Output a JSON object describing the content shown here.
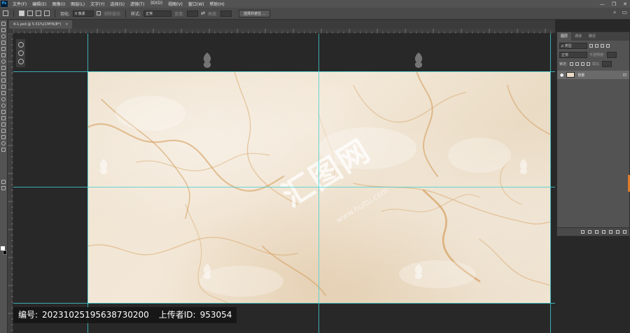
{
  "app": {
    "logo_text": "Ps"
  },
  "menu": [
    "文件(F)",
    "编辑(E)",
    "图像(I)",
    "图层(L)",
    "文字(Y)",
    "选择(S)",
    "滤镜(T)",
    "3D(D)",
    "视图(V)",
    "窗口(W)",
    "帮助(H)"
  ],
  "window_controls": {
    "minimize": "—",
    "restore": "❐",
    "close": "✕"
  },
  "options": {
    "feather_label": "羽化:",
    "feather_value": "0 像素",
    "antialias_label": "消除锯齿",
    "style_label": "样式:",
    "style_value": "正常",
    "width_label": "宽度:",
    "height_label": "高度:",
    "select_mask_button": "选择并遮住 ...",
    "search_icon": "⌕",
    "workspace_icon": "▭"
  },
  "document": {
    "tab_title": "4-1.psd @ 5.51%(CMYK/8*)",
    "close_icon": "×"
  },
  "panel": {
    "tabs": [
      "图层",
      "通道",
      "路径"
    ],
    "active_tab": 0,
    "filter_label": "ρ 类型",
    "blend_mode": "正常",
    "opacity_label": "不透明度:",
    "lock_label": "锁定:",
    "fill_label": "填充:",
    "layer_name": "背景"
  },
  "watermark": {
    "brand": "汇图网",
    "url": "www.huitu.com"
  },
  "info": {
    "id_label": "编号:",
    "id_value": "20231025195638730200",
    "uploader_label": "上传者ID:",
    "uploader_value": "953054"
  },
  "colors": {
    "accent_guide": "#41d0d4",
    "marble_vein": "#d49a55"
  }
}
